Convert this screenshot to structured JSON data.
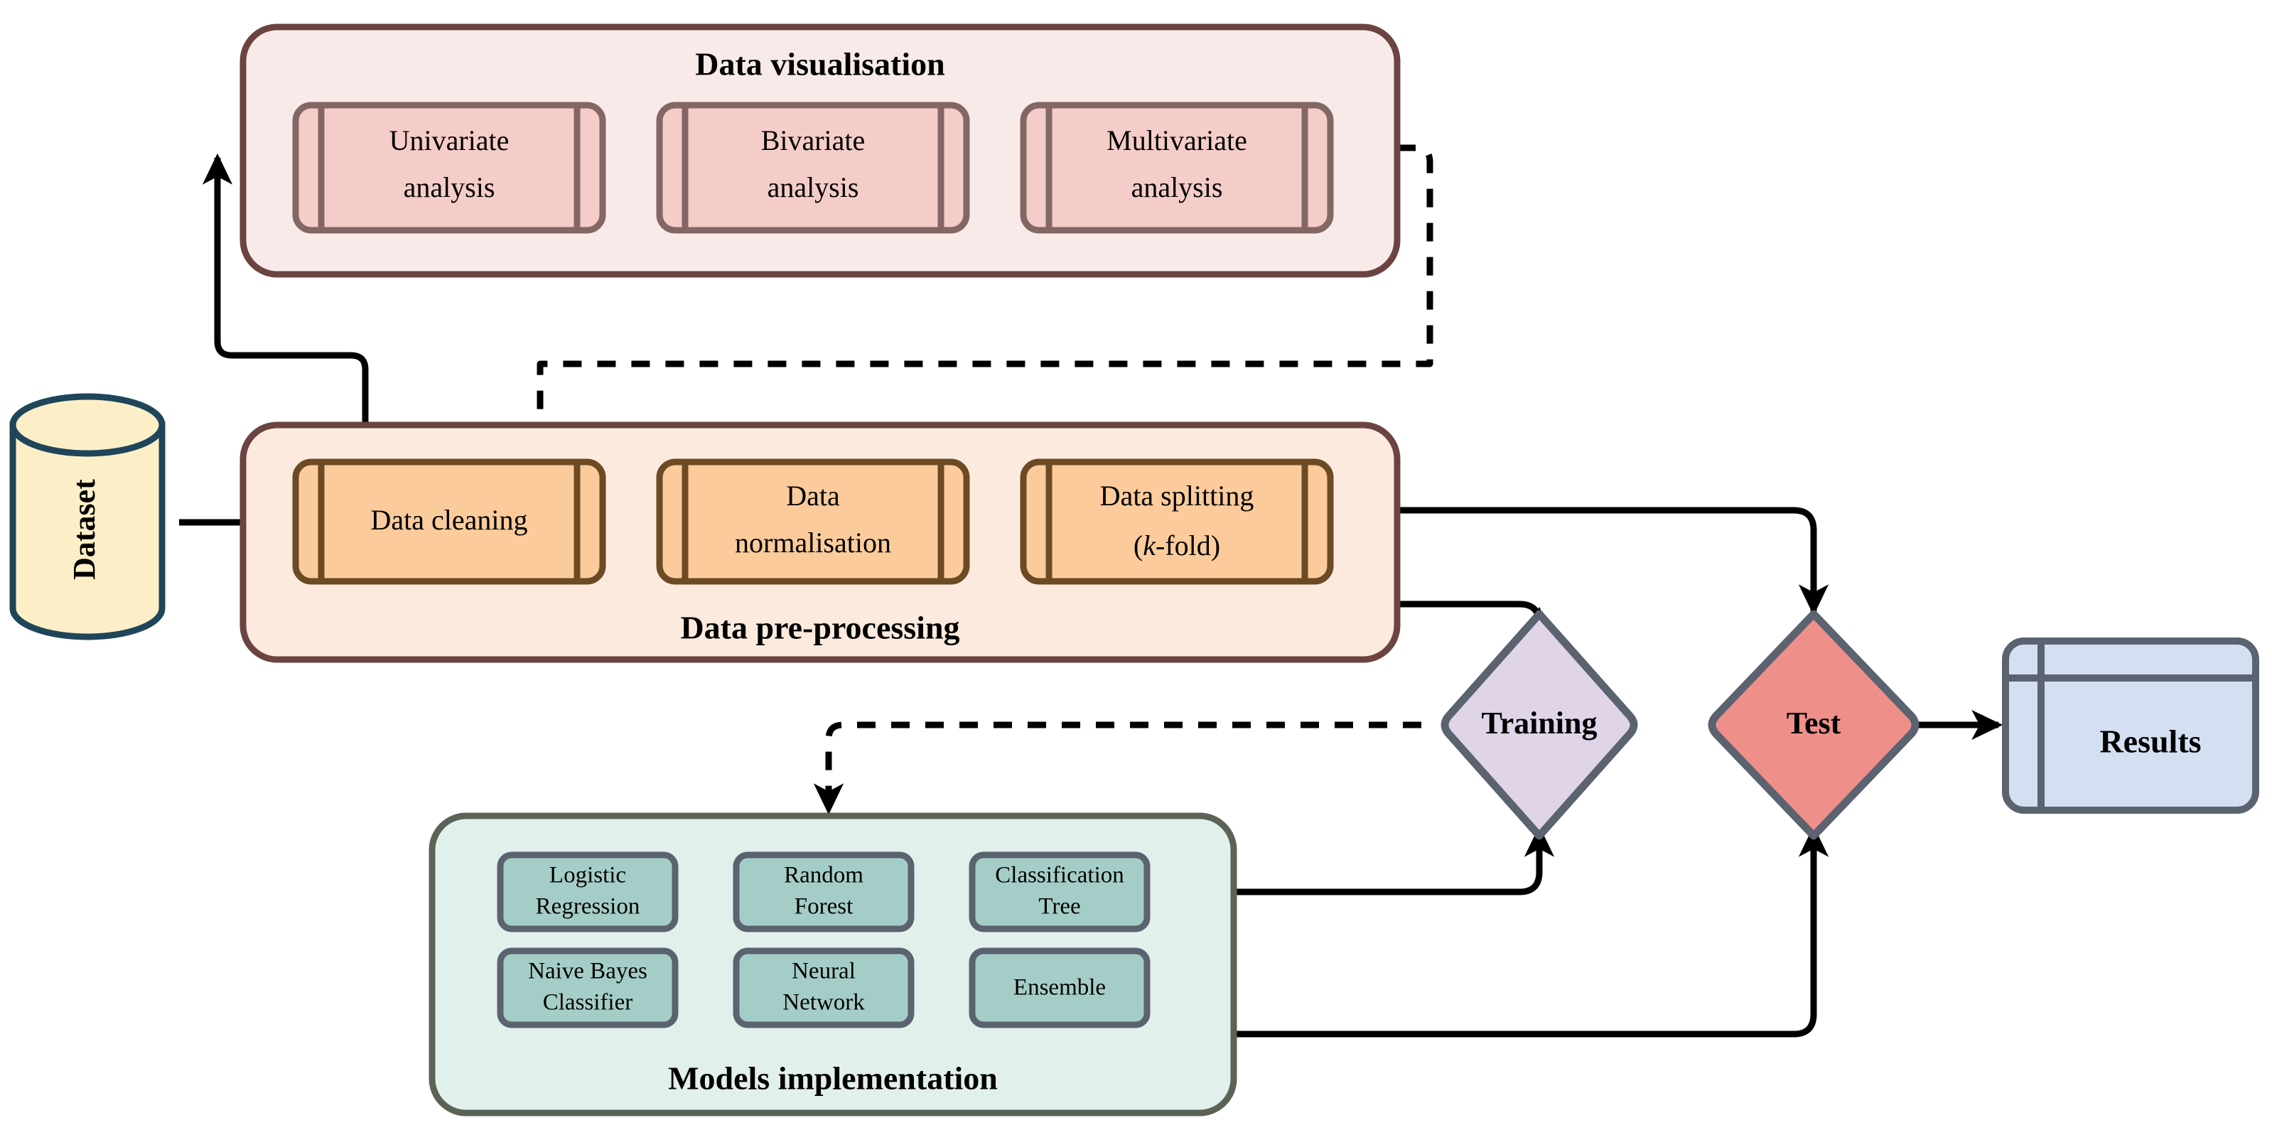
{
  "diagram": {
    "title": "Machine learning pipeline flowchart",
    "type": "flowchart"
  },
  "dataset": {
    "label": "Dataset",
    "shape": "cylinder",
    "fill": "#fcefc8",
    "stroke": "#1f4559"
  },
  "visualisation": {
    "title": "Data visualisation",
    "fill": "#f8eae8",
    "stroke": "#6b4441",
    "box_fill": "#f5cdc8",
    "box_stroke": "#836764",
    "items": [
      {
        "line1": "Univariate",
        "line2": "analysis"
      },
      {
        "line1": "Bivariate",
        "line2": "analysis"
      },
      {
        "line1": "Multivariate",
        "line2": "analysis"
      }
    ]
  },
  "preprocessing": {
    "title": "Data pre-processing",
    "fill": "#fceade",
    "stroke": "#6b4441",
    "box_fill": "#fbcb9c",
    "box_stroke": "#6b4a24",
    "items": [
      {
        "line1": "Data cleaning",
        "line2": ""
      },
      {
        "line1": "Data",
        "line2": "normalisation"
      },
      {
        "line1": "Data splitting",
        "line2": "(k-fold)",
        "italic_part": "k",
        "rest": "-fold)"
      }
    ]
  },
  "models": {
    "title": "Models implementation",
    "fill": "#e2f0ec",
    "stroke": "#5b6357",
    "box_fill": "#a5cdc7",
    "box_stroke": "#5b6270",
    "items": [
      {
        "line1": "Logistic",
        "line2": "Regression"
      },
      {
        "line1": "Random",
        "line2": "Forest"
      },
      {
        "line1": "Classification",
        "line2": "Tree"
      },
      {
        "line1": "Naive Bayes",
        "line2": "Classifier"
      },
      {
        "line1": "Neural",
        "line2": "Network"
      },
      {
        "line1": "Ensemble",
        "line2": ""
      }
    ]
  },
  "training": {
    "label": "Training",
    "shape": "diamond",
    "fill": "#e0d5e8",
    "stroke": "#5b6270"
  },
  "test": {
    "label": "Test",
    "shape": "diamond",
    "fill": "#ef8f8a",
    "stroke": "#5b6270"
  },
  "results": {
    "label": "Results",
    "shape": "tagged-document",
    "fill": "#d4e0f2",
    "stroke": "#5b6270"
  },
  "edges": [
    {
      "name": "dataset-to-cleaning",
      "style": "solid",
      "arrow": true
    },
    {
      "name": "cleaning-to-visualisation",
      "style": "solid",
      "arrow": true
    },
    {
      "name": "visualisation-to-cleaning",
      "style": "dashed",
      "arrow": true
    },
    {
      "name": "cleaning-to-normalisation",
      "style": "solid",
      "arrow": true
    },
    {
      "name": "normalisation-to-splitting",
      "style": "solid",
      "arrow": true
    },
    {
      "name": "splitting-to-test",
      "style": "solid",
      "arrow": true
    },
    {
      "name": "splitting-to-training",
      "style": "solid",
      "arrow": true
    },
    {
      "name": "training-to-models",
      "style": "dashed",
      "arrow": true
    },
    {
      "name": "models-to-training",
      "style": "solid",
      "arrow": true
    },
    {
      "name": "models-to-test",
      "style": "solid",
      "arrow": true
    },
    {
      "name": "test-to-results",
      "style": "solid",
      "arrow": true
    }
  ]
}
